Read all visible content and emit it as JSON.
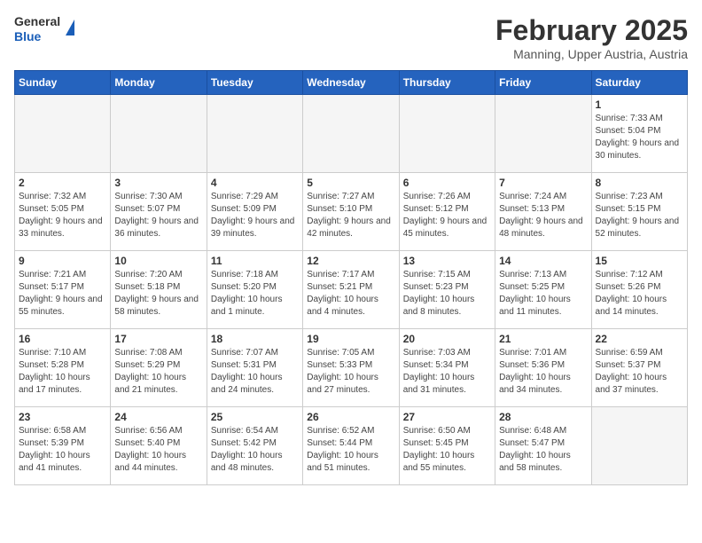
{
  "header": {
    "logo_general": "General",
    "logo_blue": "Blue",
    "month_title": "February 2025",
    "location": "Manning, Upper Austria, Austria"
  },
  "days_of_week": [
    "Sunday",
    "Monday",
    "Tuesday",
    "Wednesday",
    "Thursday",
    "Friday",
    "Saturday"
  ],
  "weeks": [
    [
      {
        "day": "",
        "info": ""
      },
      {
        "day": "",
        "info": ""
      },
      {
        "day": "",
        "info": ""
      },
      {
        "day": "",
        "info": ""
      },
      {
        "day": "",
        "info": ""
      },
      {
        "day": "",
        "info": ""
      },
      {
        "day": "1",
        "info": "Sunrise: 7:33 AM\nSunset: 5:04 PM\nDaylight: 9 hours and 30 minutes."
      }
    ],
    [
      {
        "day": "2",
        "info": "Sunrise: 7:32 AM\nSunset: 5:05 PM\nDaylight: 9 hours and 33 minutes."
      },
      {
        "day": "3",
        "info": "Sunrise: 7:30 AM\nSunset: 5:07 PM\nDaylight: 9 hours and 36 minutes."
      },
      {
        "day": "4",
        "info": "Sunrise: 7:29 AM\nSunset: 5:09 PM\nDaylight: 9 hours and 39 minutes."
      },
      {
        "day": "5",
        "info": "Sunrise: 7:27 AM\nSunset: 5:10 PM\nDaylight: 9 hours and 42 minutes."
      },
      {
        "day": "6",
        "info": "Sunrise: 7:26 AM\nSunset: 5:12 PM\nDaylight: 9 hours and 45 minutes."
      },
      {
        "day": "7",
        "info": "Sunrise: 7:24 AM\nSunset: 5:13 PM\nDaylight: 9 hours and 48 minutes."
      },
      {
        "day": "8",
        "info": "Sunrise: 7:23 AM\nSunset: 5:15 PM\nDaylight: 9 hours and 52 minutes."
      }
    ],
    [
      {
        "day": "9",
        "info": "Sunrise: 7:21 AM\nSunset: 5:17 PM\nDaylight: 9 hours and 55 minutes."
      },
      {
        "day": "10",
        "info": "Sunrise: 7:20 AM\nSunset: 5:18 PM\nDaylight: 9 hours and 58 minutes."
      },
      {
        "day": "11",
        "info": "Sunrise: 7:18 AM\nSunset: 5:20 PM\nDaylight: 10 hours and 1 minute."
      },
      {
        "day": "12",
        "info": "Sunrise: 7:17 AM\nSunset: 5:21 PM\nDaylight: 10 hours and 4 minutes."
      },
      {
        "day": "13",
        "info": "Sunrise: 7:15 AM\nSunset: 5:23 PM\nDaylight: 10 hours and 8 minutes."
      },
      {
        "day": "14",
        "info": "Sunrise: 7:13 AM\nSunset: 5:25 PM\nDaylight: 10 hours and 11 minutes."
      },
      {
        "day": "15",
        "info": "Sunrise: 7:12 AM\nSunset: 5:26 PM\nDaylight: 10 hours and 14 minutes."
      }
    ],
    [
      {
        "day": "16",
        "info": "Sunrise: 7:10 AM\nSunset: 5:28 PM\nDaylight: 10 hours and 17 minutes."
      },
      {
        "day": "17",
        "info": "Sunrise: 7:08 AM\nSunset: 5:29 PM\nDaylight: 10 hours and 21 minutes."
      },
      {
        "day": "18",
        "info": "Sunrise: 7:07 AM\nSunset: 5:31 PM\nDaylight: 10 hours and 24 minutes."
      },
      {
        "day": "19",
        "info": "Sunrise: 7:05 AM\nSunset: 5:33 PM\nDaylight: 10 hours and 27 minutes."
      },
      {
        "day": "20",
        "info": "Sunrise: 7:03 AM\nSunset: 5:34 PM\nDaylight: 10 hours and 31 minutes."
      },
      {
        "day": "21",
        "info": "Sunrise: 7:01 AM\nSunset: 5:36 PM\nDaylight: 10 hours and 34 minutes."
      },
      {
        "day": "22",
        "info": "Sunrise: 6:59 AM\nSunset: 5:37 PM\nDaylight: 10 hours and 37 minutes."
      }
    ],
    [
      {
        "day": "23",
        "info": "Sunrise: 6:58 AM\nSunset: 5:39 PM\nDaylight: 10 hours and 41 minutes."
      },
      {
        "day": "24",
        "info": "Sunrise: 6:56 AM\nSunset: 5:40 PM\nDaylight: 10 hours and 44 minutes."
      },
      {
        "day": "25",
        "info": "Sunrise: 6:54 AM\nSunset: 5:42 PM\nDaylight: 10 hours and 48 minutes."
      },
      {
        "day": "26",
        "info": "Sunrise: 6:52 AM\nSunset: 5:44 PM\nDaylight: 10 hours and 51 minutes."
      },
      {
        "day": "27",
        "info": "Sunrise: 6:50 AM\nSunset: 5:45 PM\nDaylight: 10 hours and 55 minutes."
      },
      {
        "day": "28",
        "info": "Sunrise: 6:48 AM\nSunset: 5:47 PM\nDaylight: 10 hours and 58 minutes."
      },
      {
        "day": "",
        "info": ""
      }
    ]
  ]
}
